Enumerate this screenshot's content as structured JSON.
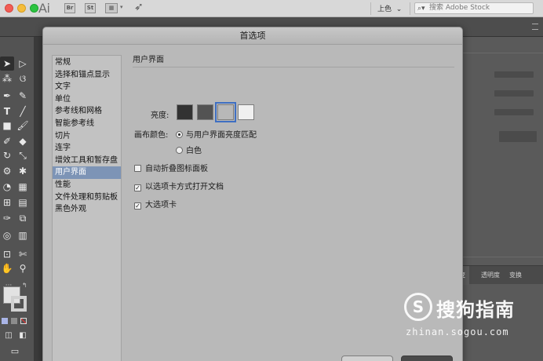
{
  "app": {
    "logo": "Ai",
    "bridge_icon": "Br",
    "stock_icon": "St",
    "color_dropdown": "上色",
    "stock_search_placeholder": "搜索 Adobe Stock"
  },
  "dialog": {
    "title": "首选项",
    "categories": [
      "常规",
      "选择和锚点显示",
      "文字",
      "单位",
      "参考线和网格",
      "智能参考线",
      "切片",
      "连字",
      "增效工具和暂存盘",
      "用户界面",
      "性能",
      "文件处理和剪贴板",
      "黑色外观"
    ],
    "selected_category_index": 9,
    "section_title": "用户界面",
    "brightness_label": "亮度:",
    "brightness_swatches": [
      "#323232",
      "#535353",
      "#b8b8b8",
      "#f0f0f0"
    ],
    "brightness_selected_index": 2,
    "canvas_color_label": "画布颜色:",
    "canvas_option_match": "与用户界面亮度匹配",
    "canvas_option_white": "白色",
    "canvas_selected": "match",
    "checkbox_auto_collapse": "自动折叠图标面板",
    "checkbox_auto_collapse_checked": false,
    "checkbox_tabs": "以选项卡方式打开文档",
    "checkbox_tabs_checked": true,
    "checkbox_large_tabs": "大选项卡",
    "checkbox_large_tabs_checked": true
  },
  "right_panel": {
    "tab_transparency": "透明度",
    "tab_transform": "变换",
    "tab_partial": "变"
  },
  "watermark": {
    "symbol": "S",
    "name": "搜狗指南",
    "url": "zhinan.sogou.com"
  }
}
